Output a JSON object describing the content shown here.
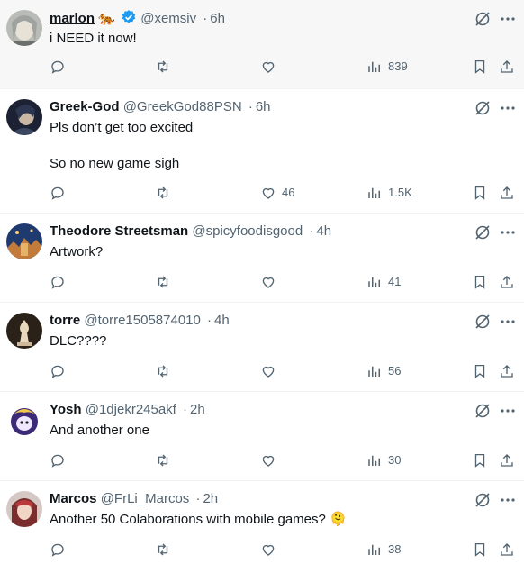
{
  "colors": {
    "text": "#0f1419",
    "muted": "#536471",
    "verified": "#1d9bf0",
    "divider": "#eff3f4"
  },
  "tweets": [
    {
      "name": "marlon",
      "name_emoji": "🐅",
      "verified": true,
      "handle": "@xemsiv",
      "sep": "·",
      "time": "6h",
      "text": "i NEED it now!",
      "likes": "",
      "views": "839"
    },
    {
      "name": "Greek-God",
      "handle": "@GreekGod88PSN",
      "sep": "·",
      "time": "6h",
      "text": "Pls don’t get too excited\n\nSo no new game sigh",
      "likes": "46",
      "views": "1.5K"
    },
    {
      "name": "Theodore Streetsman",
      "handle": "@spicyfoodisgood",
      "sep": "·",
      "time": "4h",
      "text": "Artwork?",
      "likes": "",
      "views": "41"
    },
    {
      "name": "torre",
      "handle": "@torre1505874010",
      "sep": "·",
      "time": "4h",
      "text": "DLC????",
      "likes": "",
      "views": "56"
    },
    {
      "name": "Yosh",
      "handle": "@1djekr245akf",
      "sep": "·",
      "time": "2h",
      "text": "And another one",
      "likes": "",
      "views": "30"
    },
    {
      "name": "Marcos",
      "handle": "@FrLi_Marcos",
      "sep": "·",
      "time": "2h",
      "text": "Another 50 Colaborations with mobile games? 🫠",
      "likes": "",
      "views": "38"
    }
  ]
}
